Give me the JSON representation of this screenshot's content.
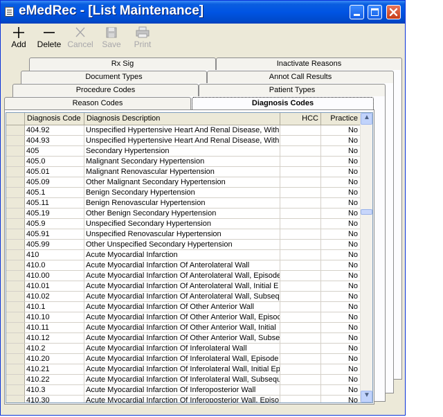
{
  "window": {
    "title": "eMedRec - [List Maintenance]",
    "title_icon": "list-document-icon"
  },
  "toolbar": {
    "add": {
      "label": "Add",
      "icon": "plus-icon",
      "enabled": true
    },
    "delete": {
      "label": "Delete",
      "icon": "minus-icon",
      "enabled": true
    },
    "cancel": {
      "label": "Cancel",
      "icon": "x-icon",
      "enabled": false
    },
    "save": {
      "label": "Save",
      "icon": "floppy-disk-icon",
      "enabled": false
    },
    "print": {
      "label": "Print",
      "icon": "printer-icon",
      "enabled": false
    }
  },
  "tabs": {
    "rx_sig": "Rx Sig",
    "inactivate_reasons": "Inactivate Reasons",
    "document_types": "Document Types",
    "annot_call_results": "Annot Call Results",
    "procedure_codes": "Procedure Codes",
    "patient_types": "Patient Types",
    "reason_codes": "Reason Codes",
    "diagnosis_codes": "Diagnosis Codes",
    "active": "Diagnosis Codes"
  },
  "grid": {
    "columns": [
      "Diagnosis Code",
      "Diagnosis Description",
      "HCC",
      "Practice"
    ],
    "rows": [
      {
        "code": "404.92",
        "desc": "Unspecified Hypertensive Heart And Renal Disease, With F",
        "hcc": "",
        "practice": "No"
      },
      {
        "code": "404.93",
        "desc": "Unspecified Hypertensive Heart And Renal Disease, With C",
        "hcc": "",
        "practice": "No"
      },
      {
        "code": "405",
        "desc": "Secondary Hypertension",
        "hcc": "",
        "practice": "No"
      },
      {
        "code": "405.0",
        "desc": "Malignant Secondary Hypertension",
        "hcc": "",
        "practice": "No"
      },
      {
        "code": "405.01",
        "desc": "Malignant Renovascular Hypertension",
        "hcc": "",
        "practice": "No"
      },
      {
        "code": "405.09",
        "desc": "Other Malignant Secondary Hypertension",
        "hcc": "",
        "practice": "No"
      },
      {
        "code": "405.1",
        "desc": "Benign Secondary Hypertension",
        "hcc": "",
        "practice": "No"
      },
      {
        "code": "405.11",
        "desc": "Benign Renovascular Hypertension",
        "hcc": "",
        "practice": "No"
      },
      {
        "code": "405.19",
        "desc": "Other Benign Secondary Hypertension",
        "hcc": "",
        "practice": "No"
      },
      {
        "code": "405.9",
        "desc": "Unspecified Secondary Hypertension",
        "hcc": "",
        "practice": "No"
      },
      {
        "code": "405.91",
        "desc": "Unspecified Renovascular Hypertension",
        "hcc": "",
        "practice": "No"
      },
      {
        "code": "405.99",
        "desc": "Other Unspecified Secondary Hypertension",
        "hcc": "",
        "practice": "No"
      },
      {
        "code": "410",
        "desc": "Acute Myocardial Infarction",
        "hcc": "",
        "practice": "No"
      },
      {
        "code": "410.0",
        "desc": "Acute Myocardial Infarction Of Anterolateral Wall",
        "hcc": "",
        "practice": "No"
      },
      {
        "code": "410.00",
        "desc": "Acute Myocardial Infarction Of Anterolateral Wall, Episode",
        "hcc": "",
        "practice": "No"
      },
      {
        "code": "410.01",
        "desc": "Acute Myocardial Infarction Of Anterolateral Wall, Initial E",
        "hcc": "",
        "practice": "No"
      },
      {
        "code": "410.02",
        "desc": "Acute Myocardial Infarction Of Anterolateral Wall, Subseq",
        "hcc": "",
        "practice": "No"
      },
      {
        "code": "410.1",
        "desc": "Acute Myocardial Infarction Of Other Anterior Wall",
        "hcc": "",
        "practice": "No"
      },
      {
        "code": "410.10",
        "desc": "Acute Myocardial Infarction Of Other Anterior Wall, Episoc",
        "hcc": "",
        "practice": "No"
      },
      {
        "code": "410.11",
        "desc": "Acute Myocardial Infarction Of Other Anterior Wall, Initial",
        "hcc": "",
        "practice": "No"
      },
      {
        "code": "410.12",
        "desc": "Acute Myocardial Infarction Of Other Anterior Wall, Subse",
        "hcc": "",
        "practice": "No"
      },
      {
        "code": "410.2",
        "desc": "Acute Myocardial Infarction Of Inferolateral Wall",
        "hcc": "",
        "practice": "No"
      },
      {
        "code": "410.20",
        "desc": "Acute Myocardial Infarction Of Inferolateral Wall, Episode",
        "hcc": "",
        "practice": "No"
      },
      {
        "code": "410.21",
        "desc": "Acute Myocardial Infarction Of Inferolateral Wall, Initial Ep",
        "hcc": "",
        "practice": "No"
      },
      {
        "code": "410.22",
        "desc": "Acute Myocardial Infarction Of Inferolateral Wall, Subsequ",
        "hcc": "",
        "practice": "No"
      },
      {
        "code": "410.3",
        "desc": "Acute Myocardial Infarction Of Inferoposterior Wall",
        "hcc": "",
        "practice": "No"
      },
      {
        "code": "410.30",
        "desc": "Acute Myocardial Infarction Of Inferoposterior Wall, Episo",
        "hcc": "",
        "practice": "No"
      }
    ]
  }
}
